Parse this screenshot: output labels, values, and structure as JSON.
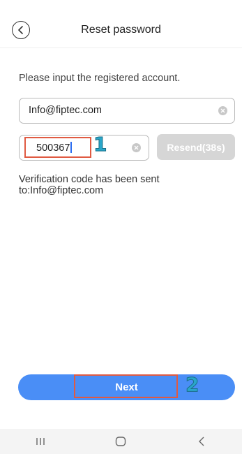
{
  "header": {
    "title": "Reset password",
    "back_icon": "chevron-left-icon"
  },
  "form": {
    "prompt": "Please input the registered account.",
    "account_value": "Info@fiptec.com",
    "code_value": "500367",
    "resend_label": "Resend(38s)",
    "sent_message": "Verification code has been sent to:Info@fiptec.com"
  },
  "annotations": {
    "step1": "1",
    "step2": "2"
  },
  "actions": {
    "next_label": "Next"
  },
  "nav_bar": {
    "icons": [
      "recent-apps-icon",
      "home-icon",
      "back-icon"
    ]
  },
  "colors": {
    "primary": "#4a8ef6",
    "disabled": "#d6d6d6",
    "highlight": "#e05a42",
    "annotation": "#2aa6c9"
  }
}
